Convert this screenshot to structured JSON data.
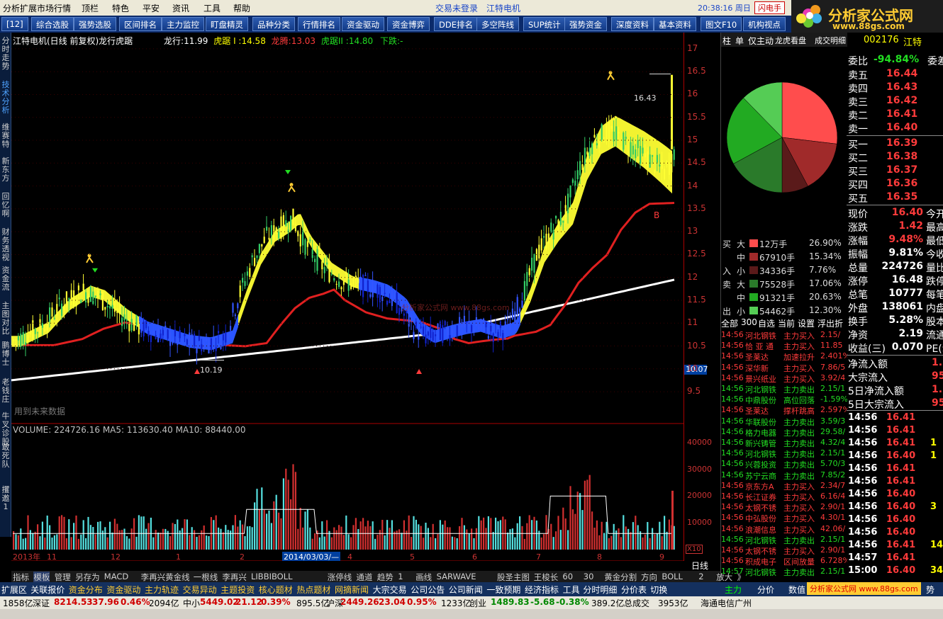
{
  "menu": {
    "items": [
      "分析",
      "扩展市场行情",
      "顶栏",
      "特色",
      "平安",
      "资讯",
      "工具",
      "帮助"
    ],
    "login_status": "交易未登录",
    "stock_title": "江特电机",
    "time": "20:38:16 周日",
    "flash_btn": "闪电手"
  },
  "logo": {
    "text": "分析家公式网",
    "url_text": "www.88gs.com"
  },
  "toolbar": [
    "[12]",
    "综合选股",
    "强势选股",
    "区间排名",
    "主力监控",
    "盯盘精灵",
    "品种分类",
    "行情排名",
    "资金驱动",
    "资金博弈",
    "DDE排名",
    "多空阵线",
    "SUP统计",
    "强势资金",
    "深度资料",
    "基本资料",
    "图文F10",
    "机构视点"
  ],
  "leftstrip": [
    "分时走势",
    "技术分析",
    "维赛特",
    "新东方",
    "回忆啊",
    "财务透视",
    "资金流",
    "主图对比",
    "鹏博士",
    "老钱庄",
    "牛叉诊股",
    "敢死队",
    "攫邀1"
  ],
  "chart_info": {
    "title": "江特电机(日线 前复权)龙行虎踞",
    "lx_label": "龙行:",
    "lx_val": "11.99",
    "hj1_label": "虎踞 I :",
    "hj1_val": "14.58",
    "lt_label": "龙腾:",
    "lt_val": "13.03",
    "hj2_label": "虎踞II :",
    "hj2_val": "14.80",
    "xd_label": "下跌:",
    "xd_val": "-",
    "volume_line": "VOLUME: 224726.16  MA5: 113630.40  MA10: 88440.00",
    "annot_high": "16.43",
    "annot_low": "10.19",
    "future_hint": "用到未来数据",
    "current_price_tag": "10.07",
    "x10": "X10",
    "watermark": "分析家公式网 www.88gs.com"
  },
  "chart_data": {
    "type": "candlestick",
    "ylim": [
      9.3,
      17.2
    ],
    "yticks": [
      9.5,
      10.0,
      10.5,
      11.0,
      11.5,
      12.0,
      12.5,
      13.0,
      13.5,
      14.0,
      14.5,
      15.0,
      15.5,
      16.0,
      16.5,
      17.0
    ],
    "vol_ylim": [
      0,
      45000
    ],
    "vol_ticks": [
      10000,
      20000,
      30000,
      40000
    ],
    "x_labels": [
      "2013年",
      "11",
      "12",
      "1",
      "2",
      "2014/03/03/—",
      "4",
      "5",
      "6",
      "7",
      "8",
      "9"
    ],
    "high_price": 16.43,
    "low_price": 10.19
  },
  "yaxis_bottom": "日线",
  "right_tabs": [
    "柱",
    "单",
    "仅主动",
    "龙虎看盘",
    "成交明细"
  ],
  "code_line": {
    "code": "002176",
    "name": "江特"
  },
  "order_book": {
    "weibi_label": "委比",
    "weibi_val": "-94.84%",
    "weicha_label": "委差",
    "sells": [
      {
        "label": "卖五",
        "price": "16.44"
      },
      {
        "label": "卖四",
        "price": "16.43"
      },
      {
        "label": "卖三",
        "price": "16.42"
      },
      {
        "label": "卖二",
        "price": "16.41"
      },
      {
        "label": "卖一",
        "price": "16.40"
      }
    ],
    "buys": [
      {
        "label": "买一",
        "price": "16.39"
      },
      {
        "label": "买二",
        "price": "16.38"
      },
      {
        "label": "买三",
        "price": "16.37"
      },
      {
        "label": "买四",
        "price": "16.36"
      },
      {
        "label": "买五",
        "price": "16.35"
      }
    ]
  },
  "quote_stats": [
    {
      "label": "现价",
      "val": "16.40",
      "extra": "今开"
    },
    {
      "label": "涨跌",
      "val": "1.42",
      "extra": "最高"
    },
    {
      "label": "涨幅",
      "val": "9.48%",
      "extra": "最低"
    },
    {
      "label": "振幅",
      "val": "9.81%",
      "extra": "今收"
    },
    {
      "label": "总量",
      "val": "224726",
      "extra": "量比"
    },
    {
      "label": "涨停",
      "val": "16.48",
      "extra": "跌停"
    },
    {
      "label": "总笔",
      "val": "10777",
      "extra": "每笔"
    },
    {
      "label": "外盘",
      "val": "138061",
      "extra": "内盘"
    },
    {
      "label": "换手",
      "val": "5.28%",
      "extra": "股本"
    },
    {
      "label": "净资",
      "val": "2.19",
      "extra": "流通"
    },
    {
      "label": "收益(三)",
      "val": "0.070",
      "extra": "PE(动"
    }
  ],
  "flow_stats": [
    {
      "label": "净流入额",
      "val": "1."
    },
    {
      "label": "大宗流入",
      "val": "95"
    },
    {
      "label": "5日净流入额",
      "val": "1."
    },
    {
      "label": "5日大宗流入",
      "val": "95"
    }
  ],
  "ticks": [
    {
      "t": "14:56",
      "p": "16.41",
      "v": ""
    },
    {
      "t": "14:56",
      "p": "16.41",
      "v": ""
    },
    {
      "t": "14:56",
      "p": "16.41",
      "v": "1"
    },
    {
      "t": "14:56",
      "p": "16.40",
      "v": "1"
    },
    {
      "t": "14:56",
      "p": "16.41",
      "v": ""
    },
    {
      "t": "14:56",
      "p": "16.41",
      "v": ""
    },
    {
      "t": "14:56",
      "p": "16.40",
      "v": ""
    },
    {
      "t": "14:56",
      "p": "16.40",
      "v": "3"
    },
    {
      "t": "14:56",
      "p": "16.40",
      "v": ""
    },
    {
      "t": "14:56",
      "p": "16.40",
      "v": ""
    },
    {
      "t": "14:56",
      "p": "16.41",
      "v": "14"
    },
    {
      "t": "14:57",
      "p": "16.41",
      "v": ""
    },
    {
      "t": "15:00",
      "p": "16.40",
      "v": "34"
    }
  ],
  "pie": {
    "slices": [
      {
        "name": "买大",
        "pct": 26.9,
        "color": "#ff4d4d"
      },
      {
        "name": "买中",
        "pct": 15.34,
        "color": "#a02a2a"
      },
      {
        "name": "买小",
        "pct": 7.76,
        "color": "#5a1a1a"
      },
      {
        "name": "卖大",
        "pct": 17.06,
        "color": "#2a7a2a"
      },
      {
        "name": "卖中",
        "pct": 20.63,
        "color": "#22aa22"
      },
      {
        "name": "卖小",
        "pct": 12.3,
        "color": "#55cc55"
      }
    ]
  },
  "flow_table": [
    {
      "side": "买",
      "size": "大",
      "vol": "12万手",
      "pct": "26.90%",
      "color": "#ff4d4d"
    },
    {
      "side": "",
      "size": "中",
      "vol": "67910手",
      "pct": "15.34%",
      "color": "#a02a2a"
    },
    {
      "side": "入",
      "size": "小",
      "vol": "34336手",
      "pct": "7.76%",
      "color": "#5a1a1a"
    },
    {
      "side": "卖",
      "size": "大",
      "vol": "75528手",
      "pct": "17.06%",
      "color": "#2a7a2a"
    },
    {
      "side": "",
      "size": "中",
      "vol": "91321手",
      "pct": "20.63%",
      "color": "#22aa22"
    },
    {
      "side": "出",
      "size": "小",
      "vol": "54462手",
      "pct": "12.30%",
      "color": "#55cc55"
    }
  ],
  "monitor_tabs": [
    "全部",
    "300",
    "自选",
    "当前",
    "设置",
    "浮出",
    "折"
  ],
  "monitor": [
    {
      "t": "14:56",
      "n": "河北钢铁",
      "a": "主力买入",
      "v": "2.15/",
      "c": "red"
    },
    {
      "t": "14:56",
      "n": "恰 亚 通",
      "a": "主力买入",
      "v": "11.85",
      "c": "red"
    },
    {
      "t": "14:56",
      "n": "圣莱达",
      "a": "加速拉升",
      "v": "2.401%",
      "c": "red"
    },
    {
      "t": "14:56",
      "n": "深华新",
      "a": "主力买入",
      "v": "7.86/5",
      "c": "red"
    },
    {
      "t": "14:56",
      "n": "景兴纸业",
      "a": "主力买入",
      "v": "3.92/4",
      "c": "red"
    },
    {
      "t": "14:56",
      "n": "河北钢铁",
      "a": "主力卖出",
      "v": "2.15/1",
      "c": "grn"
    },
    {
      "t": "14:56",
      "n": "中鼎股份",
      "a": "高位回落",
      "v": "-1.59%",
      "c": "grn"
    },
    {
      "t": "14:56",
      "n": "圣莱达",
      "a": "撑杆跳高",
      "v": "2.597%",
      "c": "red"
    },
    {
      "t": "14:56",
      "n": "华联股份",
      "a": "主力卖出",
      "v": "3.59/3",
      "c": "grn"
    },
    {
      "t": "14:56",
      "n": "格力电器",
      "a": "主力卖出",
      "v": "29.58/",
      "c": "grn"
    },
    {
      "t": "14:56",
      "n": "新兴铸管",
      "a": "主力卖出",
      "v": "4.32/4",
      "c": "grn"
    },
    {
      "t": "14:56",
      "n": "河北钢铁",
      "a": "主力卖出",
      "v": "2.15/1",
      "c": "grn"
    },
    {
      "t": "14:56",
      "n": "兴蓉投资",
      "a": "主力卖出",
      "v": "5.70/3",
      "c": "grn"
    },
    {
      "t": "14:56",
      "n": "苏宁云商",
      "a": "主力卖出",
      "v": "7.85/2",
      "c": "grn"
    },
    {
      "t": "14:56",
      "n": "京东方A",
      "a": "主力买入",
      "v": "2.34/7",
      "c": "red"
    },
    {
      "t": "14:56",
      "n": "长江证券",
      "a": "主力买入",
      "v": "6.16/4",
      "c": "red"
    },
    {
      "t": "14:56",
      "n": "太钢不锈",
      "a": "主力买入",
      "v": "2.90/1",
      "c": "red"
    },
    {
      "t": "14:56",
      "n": "中弘股份",
      "a": "主力买入",
      "v": "4.30/1",
      "c": "red"
    },
    {
      "t": "14:56",
      "n": "浪潮信息",
      "a": "主力买入",
      "v": "42.06/",
      "c": "red"
    },
    {
      "t": "14:56",
      "n": "河北钢铁",
      "a": "主力卖出",
      "v": "2.15/1",
      "c": "grn"
    },
    {
      "t": "14:56",
      "n": "太钢不锈",
      "a": "主力买入",
      "v": "2.90/1",
      "c": "red"
    },
    {
      "t": "14:56",
      "n": "积成电子",
      "a": "区间放量",
      "v": "6.728%",
      "c": "red"
    },
    {
      "t": "14:57",
      "n": "河北钢铁",
      "a": "主力卖出",
      "v": "2.15/1",
      "c": "grn"
    }
  ],
  "bottom_tabs1": [
    "指标",
    "模板",
    "管理",
    "另存为",
    "MACD",
    "李再兴黄金线",
    "一根线",
    "李再兴",
    "LIBBIBOLL",
    "涨停线",
    "通道",
    "趋势",
    "1",
    "画线",
    "SARWAVE",
    "股圣主图",
    "王梭长",
    "60",
    "30",
    "黄金分割",
    "方向",
    "BOLL",
    "2",
    "放大",
    "》"
  ],
  "bottom_tabs2": [
    "扩展区",
    "关联报价",
    "资金分布",
    "资金驱动",
    "主力轨迹",
    "交易异动",
    "主题投资",
    "核心题材",
    "热点题材",
    "网摘新闻",
    "大宗交易",
    "公司公告",
    "公司新闻",
    "一致预期",
    "经济指标",
    "工具",
    "分时明细",
    "分价表",
    "切换"
  ],
  "right_bottom_tabs": [
    "主力",
    "分价",
    "数值",
    "分析家公式网 www.88gs.com",
    "势"
  ],
  "status": [
    {
      "text": "1858亿",
      "c": "blk"
    },
    {
      "text": "深证",
      "c": "blk"
    },
    {
      "text": "8214.53",
      "c": "red"
    },
    {
      "text": "37.96",
      "c": "red"
    },
    {
      "text": "0.46%",
      "c": "red"
    },
    {
      "text": "2094亿",
      "c": "blk"
    },
    {
      "text": "中小",
      "c": "blk"
    },
    {
      "text": "5449.02",
      "c": "red"
    },
    {
      "text": "21.12",
      "c": "red"
    },
    {
      "text": "0.39%",
      "c": "red"
    },
    {
      "text": "895.5亿",
      "c": "blk"
    },
    {
      "text": "沪深",
      "c": "blk"
    },
    {
      "text": "2449.26",
      "c": "red"
    },
    {
      "text": "23.04",
      "c": "red"
    },
    {
      "text": "0.95%",
      "c": "red"
    },
    {
      "text": "1233亿",
      "c": "blk"
    },
    {
      "text": "创业",
      "c": "blk"
    },
    {
      "text": "1489.83",
      "c": "grn"
    },
    {
      "text": "-5.68",
      "c": "grn"
    },
    {
      "text": "-0.38%",
      "c": "grn"
    },
    {
      "text": "389.2亿",
      "c": "blk"
    },
    {
      "text": "总成交",
      "c": "blk"
    },
    {
      "text": "3953亿",
      "c": "blk"
    },
    {
      "text": "海通电信广州",
      "c": "blk"
    }
  ],
  "colors": {
    "up": "#ff3b3b",
    "down": "#22dd22",
    "bg": "#000000",
    "grid": "#5a0000"
  }
}
